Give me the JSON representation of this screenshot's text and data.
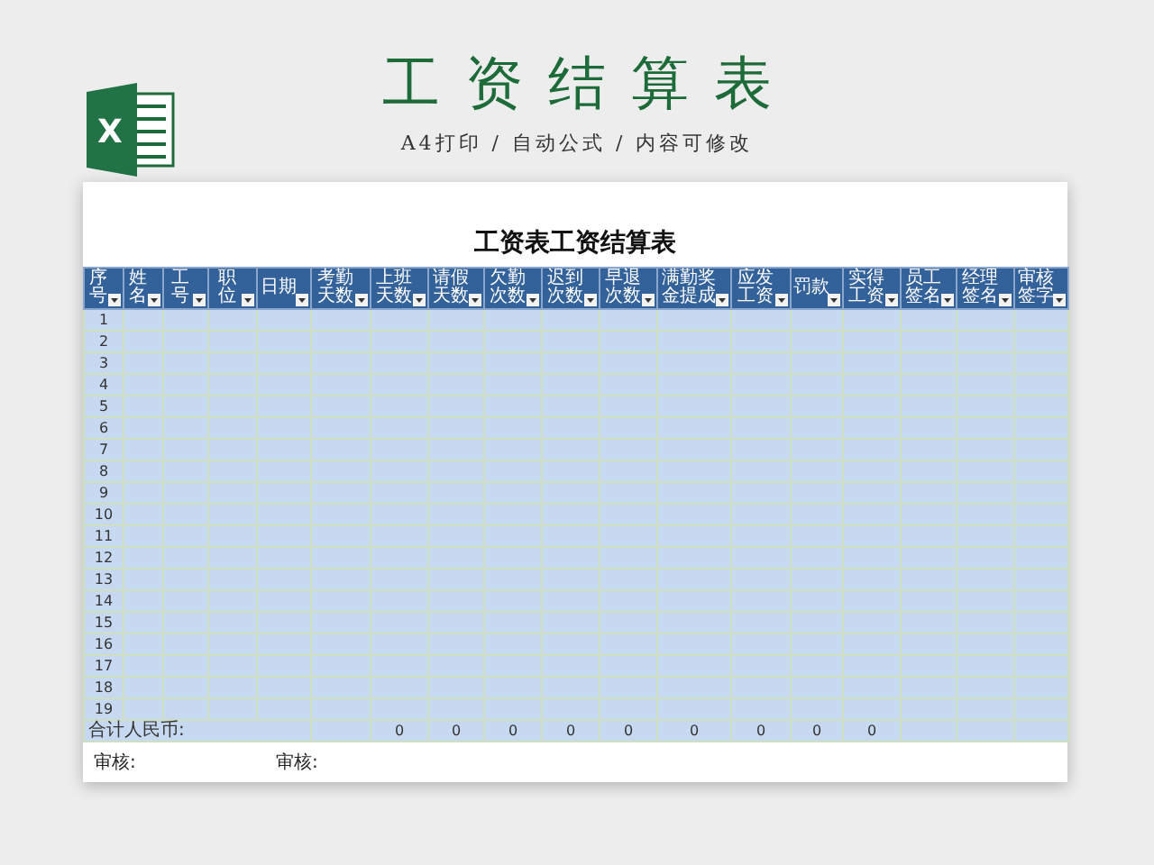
{
  "logo": {
    "letter": "X"
  },
  "title": "工资结算表",
  "subtitle": "A4打印 / 自动公式 / 内容可修改",
  "sheet": {
    "title": "工资表工资结算表",
    "columns": [
      "序号",
      "姓名",
      "工号",
      "职位",
      "日期",
      "考勤天数",
      "上班天数",
      "请假天数",
      "欠勤次数",
      "迟到次数",
      "早退次数",
      "满勤奖金提成",
      "应发工资",
      "罚款",
      "实得工资",
      "员工签名",
      "经理签名",
      "审核签字"
    ],
    "rows": [
      "1",
      "2",
      "3",
      "4",
      "5",
      "6",
      "7",
      "8",
      "9",
      "10",
      "11",
      "12",
      "13",
      "14",
      "15",
      "16",
      "17",
      "18",
      "19"
    ],
    "totals": {
      "label": "合计人民币:",
      "values": [
        "0",
        "0",
        "0",
        "0",
        "0",
        "0",
        "0",
        "0",
        "0"
      ]
    },
    "signatures": [
      "审核:",
      "审核:"
    ]
  }
}
